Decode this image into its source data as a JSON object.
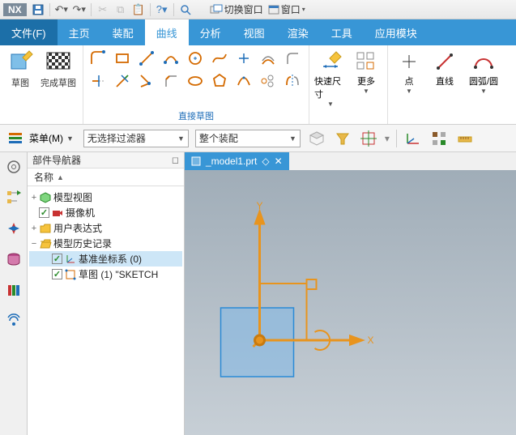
{
  "app_name": "NX",
  "titlebar": {
    "window_switch": "切换窗口",
    "window_menu": "窗口"
  },
  "tabs": {
    "file": "文件(F)",
    "home": "主页",
    "assembly": "装配",
    "curve": "曲线",
    "analyze": "分析",
    "view": "视图",
    "render": "渲染",
    "tools": "工具",
    "application": "应用模块"
  },
  "ribbon": {
    "sketch": "草图",
    "finish_sketch": "完成草图",
    "direct_sketch_group": "直接草图",
    "quick_dim": "快速尺寸",
    "more": "更多",
    "point": "点",
    "line": "直线",
    "arc_circle": "圆弧/圆"
  },
  "selbar": {
    "menu": "菜单(M)",
    "filter_none": "无选择过滤器",
    "assembly_scope": "整个装配"
  },
  "nav": {
    "title": "部件导航器",
    "col_name": "名称",
    "items": {
      "model_view": "模型视图",
      "camera": "摄像机",
      "user_expr": "用户表达式",
      "history": "模型历史记录",
      "datum_csys": "基准坐标系 (0)",
      "sketch": "草图 (1) \"SKETCH"
    }
  },
  "doc": {
    "tab_name": "_model1.prt",
    "pinned_glyph": "◇",
    "close_glyph": "✕"
  },
  "axes": {
    "x": "X",
    "y": "Y"
  }
}
